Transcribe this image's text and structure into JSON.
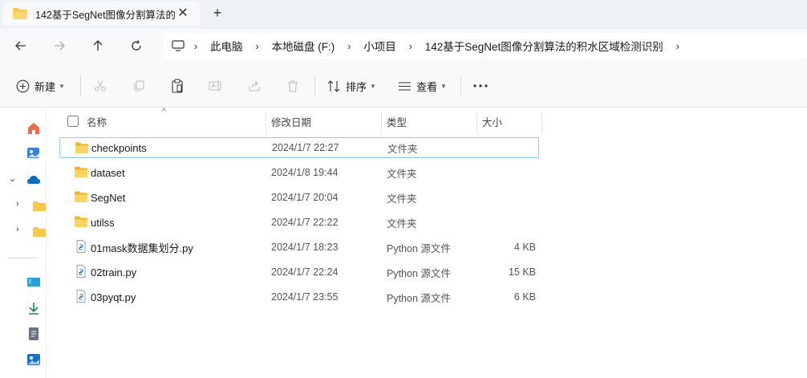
{
  "tab": {
    "title": "142基于SegNet图像分割算法的",
    "close_icon": "close-icon"
  },
  "address": {
    "segments": [
      "此电脑",
      "本地磁盘 (F:)",
      "小项目",
      "142基于SegNet图像分割算法的积水区域检测识别"
    ]
  },
  "toolbar": {
    "new_label": "新建",
    "sort_label": "排序",
    "view_label": "查看"
  },
  "columns": {
    "name": "名称",
    "date": "修改日期",
    "type": "类型",
    "size": "大小"
  },
  "files": [
    {
      "name": "checkpoints",
      "date": "2024/1/7 22:27",
      "type": "文件夹",
      "size": "",
      "icon": "folder-icon"
    },
    {
      "name": "dataset",
      "date": "2024/1/8 19:44",
      "type": "文件夹",
      "size": "",
      "icon": "folder-icon"
    },
    {
      "name": "SegNet",
      "date": "2024/1/7 20:04",
      "type": "文件夹",
      "size": "",
      "icon": "folder-icon"
    },
    {
      "name": "utilss",
      "date": "2024/1/7 22:22",
      "type": "文件夹",
      "size": "",
      "icon": "folder-icon"
    },
    {
      "name": "01mask数据集划分.py",
      "date": "2024/1/7 18:23",
      "type": "Python 源文件",
      "size": "4 KB",
      "icon": "python-file-icon"
    },
    {
      "name": "02train.py",
      "date": "2024/1/7 22:24",
      "type": "Python 源文件",
      "size": "15 KB",
      "icon": "python-file-icon"
    },
    {
      "name": "03pyqt.py",
      "date": "2024/1/7 23:55",
      "type": "Python 源文件",
      "size": "6 KB",
      "icon": "python-file-icon"
    }
  ],
  "colors": {
    "accent": "#0067c0",
    "folder": "#f8c847",
    "selection_border": "#99c9ef"
  }
}
